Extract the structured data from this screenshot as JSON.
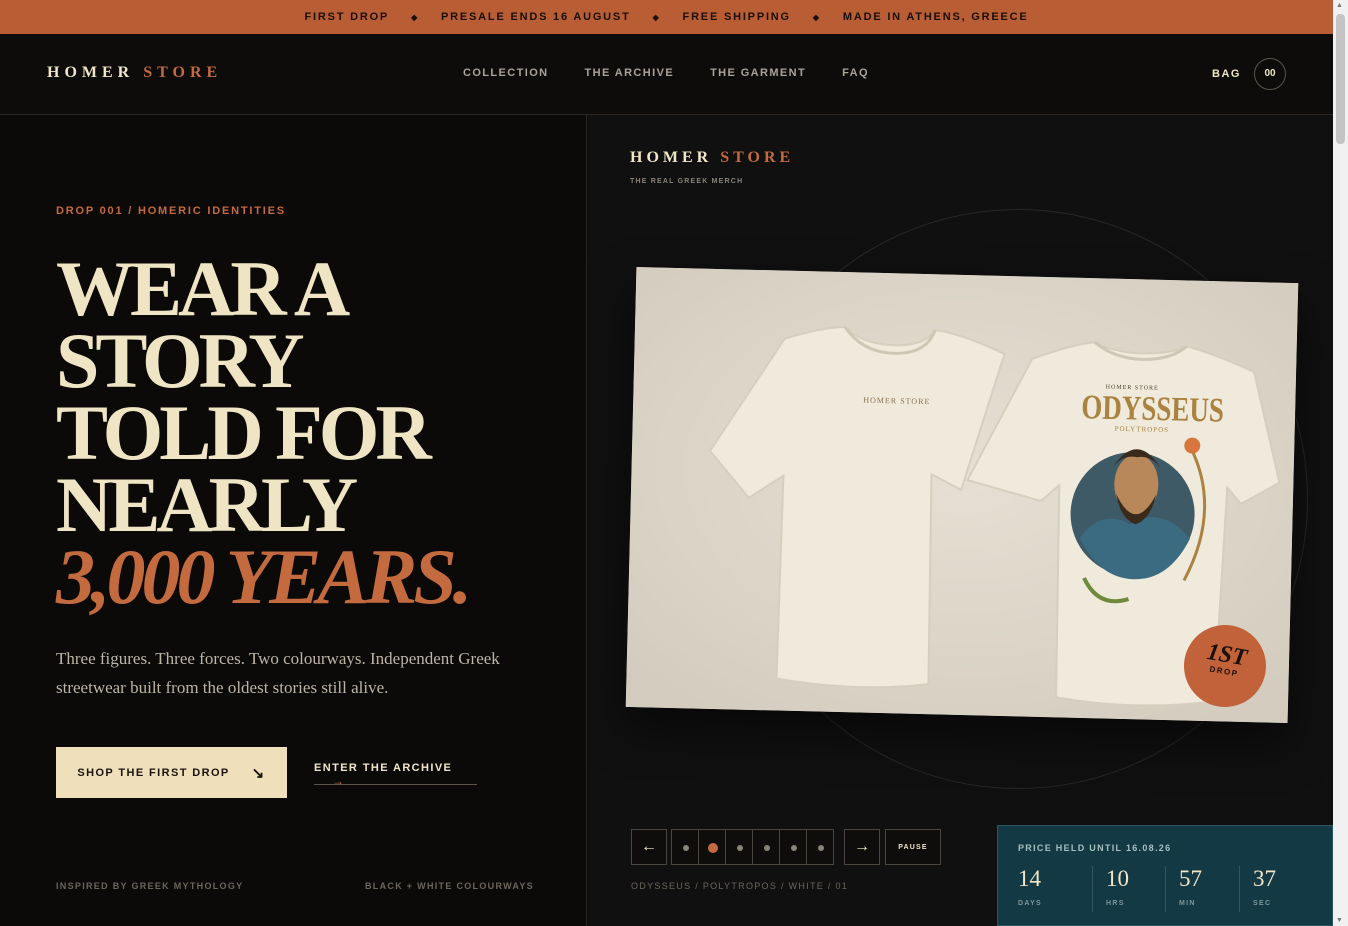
{
  "announcement": {
    "items": [
      "FIRST DROP",
      "PRESALE ENDS 16 AUGUST",
      "FREE SHIPPING",
      "MADE IN ATHENS, GREECE"
    ],
    "separator": "◆"
  },
  "header": {
    "logo_main": "HOMER",
    "logo_accent": "STORE",
    "nav": [
      "COLLECTION",
      "THE ARCHIVE",
      "THE GARMENT",
      "FAQ"
    ],
    "bag_label": "BAG",
    "bag_count": "00"
  },
  "hero": {
    "eyebrow": "DROP 001 / HOMERIC IDENTITIES",
    "headline_lines": [
      "WEAR A",
      "STORY",
      "TOLD FOR",
      "NEARLY"
    ],
    "headline_emphasis": "3,000 YEARS.",
    "lede": "Three figures. Three forces. Two colourways. Independent Greek streetwear built from the oldest stories still alive.",
    "primary_cta": "SHOP THE FIRST DROP",
    "primary_cta_icon": "↘",
    "secondary_cta": "ENTER THE ARCHIVE",
    "secondary_cta_icon": "→",
    "footnote_left": "INSPIRED BY GREEK MYTHOLOGY",
    "footnote_right": "BLACK + WHITE COLOURWAYS"
  },
  "showcase": {
    "brand_main": "HOMER",
    "brand_accent": "STORE",
    "brand_sub": "THE REAL GREEK MERCH",
    "shirt_front_print": "HOMER STORE",
    "shirt_back_top": "HOMER STORE",
    "shirt_back_title": "ODYSSEUS",
    "shirt_back_subtitle": "POLYTROPOS",
    "badge_top": "1ST",
    "badge_bottom": "DROP",
    "prev_icon": "←",
    "next_icon": "→",
    "pause_label": "PAUSE",
    "slide_count": 6,
    "active_slide": 2,
    "caption": "ODYSSEUS / POLYTROPOS / WHITE / 01"
  },
  "price_hold": {
    "label": "PRICE HELD UNTIL 16.08.26",
    "countdown": [
      {
        "value": "14",
        "unit": "DAYS"
      },
      {
        "value": "10",
        "unit": "HRS"
      },
      {
        "value": "57",
        "unit": "MIN"
      },
      {
        "value": "37",
        "unit": "SEC"
      }
    ]
  },
  "colors": {
    "accent": "#c46a3f",
    "announcement_bg": "#b95d34",
    "cream": "#efe4c4",
    "price_panel_bg": "#133a44"
  }
}
